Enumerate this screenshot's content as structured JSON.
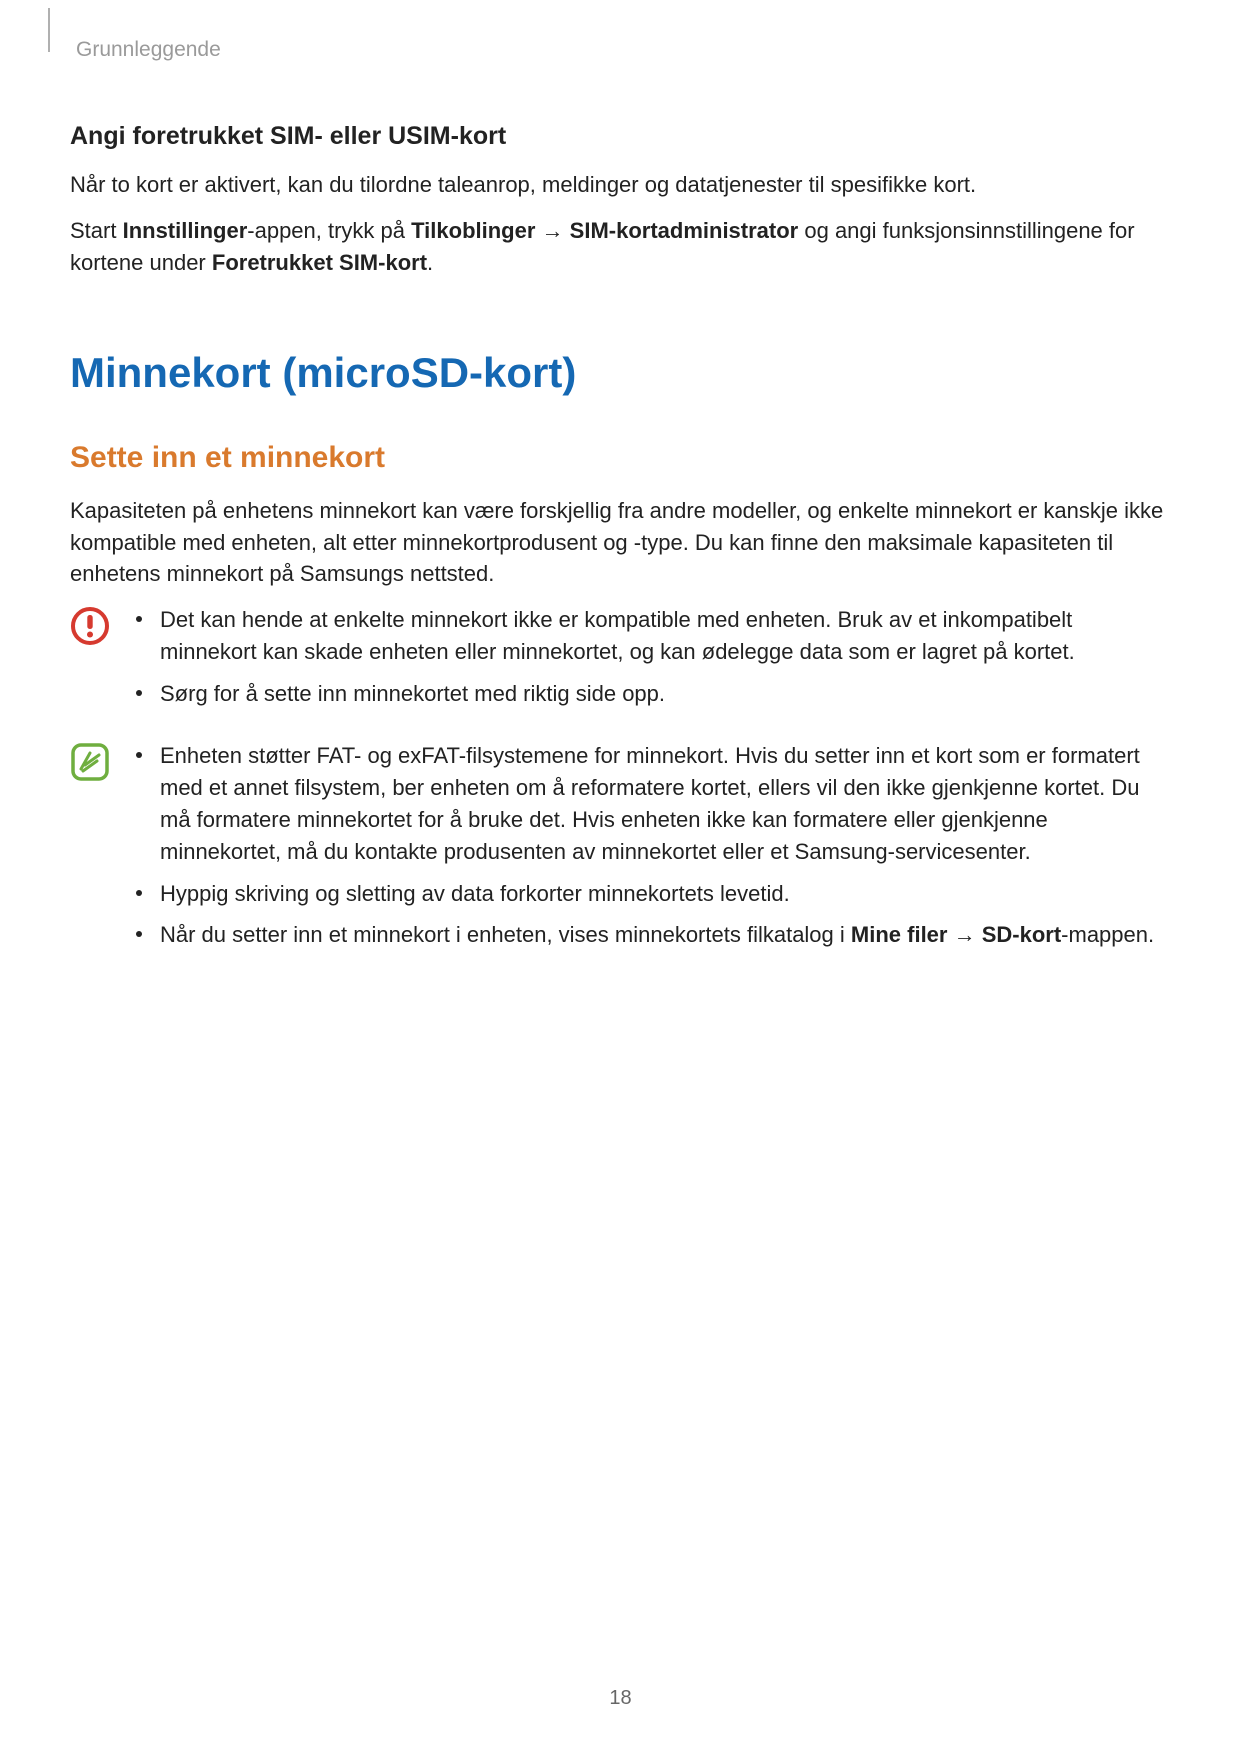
{
  "chapter": "Grunnleggende",
  "section1": {
    "heading": "Angi foretrukket SIM- eller USIM-kort",
    "para1": "Når to kort er aktivert, kan du tilordne taleanrop, meldinger og datatjenester til spesifikke kort.",
    "para2_pre": "Start ",
    "para2_b1": "Innstillinger",
    "para2_mid1": "-appen, trykk på ",
    "para2_b2": "Tilkoblinger",
    "para2_arrow": " → ",
    "para2_b3": "SIM-kortadministrator",
    "para2_mid2": " og angi funksjonsinnstillingene for kortene under ",
    "para2_b4": "Foretrukket SIM-kort",
    "para2_end": "."
  },
  "h1": "Minnekort (microSD-kort)",
  "section2": {
    "heading": "Sette inn et minnekort",
    "para": "Kapasiteten på enhetens minnekort kan være forskjellig fra andre modeller, og enkelte minnekort er kanskje ikke kompatible med enheten, alt etter minnekortprodusent og -type. Du kan finne den maksimale kapasiteten til enhetens minnekort på Samsungs nettsted."
  },
  "warning": {
    "bullets": [
      "Det kan hende at enkelte minnekort ikke er kompatible med enheten. Bruk av et inkompatibelt minnekort kan skade enheten eller minnekortet, og kan ødelegge data som er lagret på kortet.",
      "Sørg for å sette inn minnekortet med riktig side opp."
    ]
  },
  "note": {
    "bullet1": "Enheten støtter FAT- og exFAT-filsystemene for minnekort. Hvis du setter inn et kort som er formatert med et annet filsystem, ber enheten om å reformatere kortet, ellers vil den ikke gjenkjenne kortet. Du må formatere minnekortet for å bruke det. Hvis enheten ikke kan formatere eller gjenkjenne minnekortet, må du kontakte produsenten av minnekortet eller et Samsung-servicesenter.",
    "bullet2": "Hyppig skriving og sletting av data forkorter minnekortets levetid.",
    "bullet3_pre": "Når du setter inn et minnekort i enheten, vises minnekortets filkatalog i ",
    "bullet3_b1": "Mine filer",
    "bullet3_arrow": " → ",
    "bullet3_b2": "SD-kort",
    "bullet3_end": "-mappen."
  },
  "pageNumber": "18"
}
